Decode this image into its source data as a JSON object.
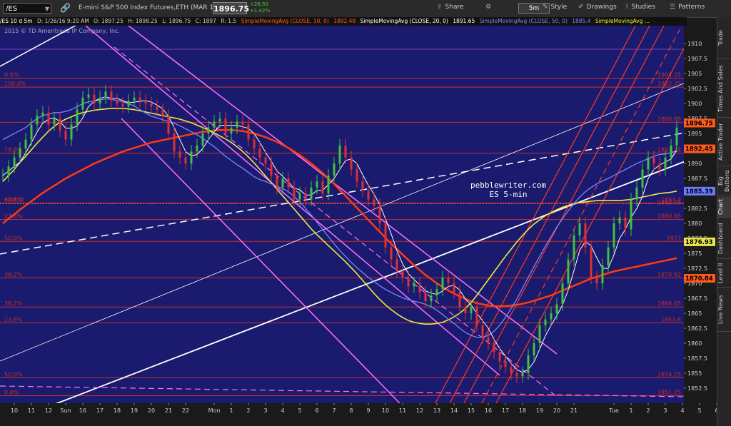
{
  "toolbar": {
    "symbol": "/ES",
    "description": "E-mini S&P 500 Index Futures,ETH (MAR 16)",
    "last": "1896.75",
    "change": "+26.50",
    "change_pct": "+1.42%",
    "share": "Share",
    "timeframe": "5m",
    "style": "Style",
    "drawings": "Drawings",
    "studies": "Studies",
    "patterns": "Patterns"
  },
  "infobar": {
    "label": "/ES 10 d 5m",
    "date": "D: 1/26/16 9:20 AM",
    "open": "O: 1897.25",
    "high": "H: 1898.25",
    "low": "L: 1896.75",
    "close": "C: 1897",
    "r": "R: 1.5",
    "sma10": "SimpleMovingAvg (CLOSE, 10, 0)",
    "sma10_val": "1892.48",
    "sma20": "SimpleMovingAvg (CLOSE, 20, 0)",
    "sma20_val": "1891.65",
    "sma50": "SimpleMovingAvg (CLOSE, 50, 0)",
    "sma50_val": "1885.4",
    "sma200": "SimpleMovingAvg ..."
  },
  "sidebar": [
    "Trade",
    "Times And Sales",
    "Active Trader",
    "Big Buttons",
    "Chart",
    "Dashboard",
    "Level II",
    "Live News"
  ],
  "chart_data": {
    "type": "line",
    "copyright": "2015 © TD Ameritrade IP Company, Inc.",
    "watermark_site": "pebblewriter.com",
    "watermark_sub": "ES 5-min",
    "ylim": [
      1850,
      1913
    ],
    "y_ticks": [
      1852.5,
      1855,
      1857.5,
      1860,
      1862.5,
      1865,
      1867.5,
      1870,
      1872.5,
      1875,
      1877.5,
      1880,
      1882.5,
      1885,
      1887.5,
      1890,
      1892.5,
      1895,
      1897.5,
      1900,
      1902.5,
      1905,
      1907.5,
      1910
    ],
    "x_ticks": [
      {
        "label": "10",
        "i": 2
      },
      {
        "label": "11",
        "i": 5
      },
      {
        "label": "12",
        "i": 8
      },
      {
        "label": "Sun",
        "i": 11
      },
      {
        "label": "16",
        "i": 14
      },
      {
        "label": "17",
        "i": 17
      },
      {
        "label": "18",
        "i": 20
      },
      {
        "label": "19",
        "i": 23
      },
      {
        "label": "20",
        "i": 26
      },
      {
        "label": "21",
        "i": 29
      },
      {
        "label": "22",
        "i": 32
      },
      {
        "label": "Mon",
        "i": 37
      },
      {
        "label": "1",
        "i": 40
      },
      {
        "label": "2",
        "i": 43
      },
      {
        "label": "3",
        "i": 46
      },
      {
        "label": "4",
        "i": 49
      },
      {
        "label": "5",
        "i": 52
      },
      {
        "label": "6",
        "i": 55
      },
      {
        "label": "7",
        "i": 58
      },
      {
        "label": "8",
        "i": 61
      },
      {
        "label": "9",
        "i": 64
      },
      {
        "label": "10",
        "i": 67
      },
      {
        "label": "11",
        "i": 70
      },
      {
        "label": "12",
        "i": 73
      },
      {
        "label": "13",
        "i": 76
      },
      {
        "label": "14",
        "i": 79
      },
      {
        "label": "15",
        "i": 82
      },
      {
        "label": "16",
        "i": 85
      },
      {
        "label": "17",
        "i": 88
      },
      {
        "label": "18",
        "i": 91
      },
      {
        "label": "19",
        "i": 94
      },
      {
        "label": "20",
        "i": 97
      },
      {
        "label": "21",
        "i": 100
      },
      {
        "label": "Tue",
        "i": 107
      },
      {
        "label": "1",
        "i": 110
      },
      {
        "label": "2",
        "i": 113
      },
      {
        "label": "3",
        "i": 116
      },
      {
        "label": "4",
        "i": 119
      },
      {
        "label": "5",
        "i": 122
      },
      {
        "label": "6",
        "i": 125
      },
      {
        "label": "7",
        "i": 128
      },
      {
        "label": "8",
        "i": 131
      },
      {
        "label": "9",
        "i": 134
      },
      {
        "label": "10",
        "i": 137
      },
      {
        "label": "11",
        "i": 140
      },
      {
        "label": "12",
        "i": 143
      },
      {
        "label": "13",
        "i": 146
      },
      {
        "label": "14",
        "i": 149
      },
      {
        "label": "15",
        "i": 152
      }
    ],
    "close": [
      1888,
      1889.5,
      1891,
      1892.5,
      1894,
      1896.5,
      1898,
      1898.5,
      1896.5,
      1897.5,
      1895.5,
      1894,
      1896.5,
      1899,
      1901,
      1901.5,
      1900,
      1901,
      1902,
      1900.5,
      1900,
      1899.5,
      1900.5,
      1901,
      1900.5,
      1900,
      1899.5,
      1899,
      1898,
      1895,
      1892,
      1891,
      1890,
      1892,
      1893,
      1895,
      1896,
      1897,
      1897.5,
      1895,
      1896,
      1897,
      1896.5,
      1894,
      1892.5,
      1891,
      1890,
      1888,
      1886,
      1887.5,
      1886,
      1884,
      1885,
      1884,
      1886,
      1887,
      1885,
      1888,
      1890,
      1893,
      1891,
      1889,
      1887,
      1885.5,
      1884,
      1883,
      1880,
      1876,
      1874,
      1872,
      1871,
      1869.5,
      1870,
      1868.5,
      1867,
      1868,
      1869,
      1871,
      1870,
      1868.5,
      1866,
      1865,
      1866,
      1863,
      1861,
      1860,
      1858.5,
      1857,
      1856,
      1855,
      1854.5,
      1855,
      1858,
      1860,
      1863,
      1864,
      1865,
      1866.5,
      1870,
      1874,
      1878,
      1880,
      1876,
      1871,
      1870,
      1873,
      1876,
      1880,
      1881,
      1879,
      1884,
      1886,
      1889,
      1891,
      1890,
      1889,
      1891,
      1893,
      1896
    ],
    "sma20": [
      1894,
      1894.5,
      1895,
      1895.5,
      1896,
      1896.8,
      1897.5,
      1898,
      1898.2,
      1898.5,
      1898.5,
      1898.7,
      1899,
      1899.5,
      1900,
      1900.3,
      1900.4,
      1900.6,
      1900.8,
      1900.7,
      1900.5,
      1900.3,
      1900,
      1899.6,
      1899,
      1898.4,
      1897.9,
      1897.6,
      1897.3,
      1897,
      1896.7,
      1896.3,
      1895.8,
      1895.3,
      1894.8,
      1894.2,
      1893.5,
      1892.8,
      1892,
      1891.2,
      1890.5,
      1889.8,
      1889.2,
      1888.5,
      1887.8,
      1887.3,
      1887,
      1886.6,
      1886.2,
      1885.8,
      1885.3,
      1884.5,
      1883.6,
      1882.5,
      1881.4,
      1880.2,
      1879,
      1877.8,
      1876.6,
      1875.5,
      1874.5,
      1873.5,
      1872.6,
      1871.8,
      1871,
      1870.3,
      1869.6,
      1869,
      1868.5,
      1868,
      1867.6,
      1867.3,
      1867,
      1866.8,
      1866.5,
      1866.1,
      1865.5,
      1864.8,
      1864,
      1863.3,
      1862.5,
      1861.8,
      1861.3,
      1861,
      1861,
      1861.3,
      1862,
      1863,
      1864.3,
      1865.8,
      1867.4,
      1869.2,
      1871,
      1872.8,
      1874.5,
      1876.2,
      1877.8,
      1879.4,
      1880.8,
      1882.1,
      1883.3,
      1884.4,
      1885.3,
      1886,
      1886.6,
      1887.1,
      1887.5,
      1888,
      1888.5,
      1889,
      1889.5,
      1890,
      1890.4,
      1890.8,
      1891.2,
      1891.5,
      1891.6,
      1891.8,
      1892.1
    ],
    "sma50": [
      1887,
      1888,
      1889,
      1890.2,
      1891.2,
      1892.3,
      1893.4,
      1894.4,
      1895.4,
      1896.2,
      1896.9,
      1897.4,
      1897.8,
      1898.2,
      1898.5,
      1898.7,
      1898.9,
      1899,
      1899.1,
      1899.2,
      1899.2,
      1899.2,
      1899.1,
      1899,
      1898.8,
      1898.6,
      1898.4,
      1898.2,
      1898,
      1897.8,
      1897.6,
      1897.4,
      1897.1,
      1896.8,
      1896.4,
      1896,
      1895.6,
      1895.1,
      1894.6,
      1894.1,
      1893.5,
      1892.8,
      1892,
      1891.1,
      1890.1,
      1889,
      1887.9,
      1886.8,
      1885.7,
      1884.6,
      1883.5,
      1882.4,
      1881.3,
      1880.2,
      1879.1,
      1878.1,
      1877.2,
      1876.3,
      1875.4,
      1874.5,
      1873.6,
      1872.6,
      1871.6,
      1870.5,
      1869.4,
      1868.3,
      1867.3,
      1866.4,
      1865.6,
      1864.9,
      1864.3,
      1863.8,
      1863.5,
      1863.3,
      1863.2,
      1863.2,
      1863.3,
      1863.5,
      1863.9,
      1864.4,
      1865,
      1865.8,
      1866.8,
      1868,
      1869.3,
      1870.6,
      1871.9,
      1873.2,
      1874.5,
      1875.7,
      1876.9,
      1878,
      1879,
      1879.9,
      1880.6,
      1881.3,
      1881.8,
      1882.3,
      1882.7,
      1883,
      1883.3,
      1883.5,
      1883.6,
      1883.7,
      1883.8,
      1883.8,
      1883.8,
      1883.8,
      1883.8,
      1883.9,
      1884,
      1884.2,
      1884.4,
      1884.6,
      1884.8,
      1885,
      1885.1,
      1885.2,
      1885.4
    ],
    "sma200": [
      1880,
      1880.8,
      1881.5,
      1882.3,
      1883,
      1883.7,
      1884.4,
      1885.1,
      1885.7,
      1886.3,
      1886.9,
      1887.5,
      1888,
      1888.5,
      1889,
      1889.5,
      1890,
      1890.4,
      1890.8,
      1891.2,
      1891.6,
      1892,
      1892.3,
      1892.6,
      1892.9,
      1893.2,
      1893.5,
      1893.7,
      1893.9,
      1894.1,
      1894.3,
      1894.5,
      1894.7,
      1894.9,
      1895.1,
      1895.3,
      1895.4,
      1895.5,
      1895.6,
      1895.6,
      1895.6,
      1895.5,
      1895.4,
      1895.2,
      1895,
      1894.7,
      1894.4,
      1894,
      1893.6,
      1893.1,
      1892.6,
      1892,
      1891.4,
      1890.7,
      1890,
      1889.2,
      1888.4,
      1887.5,
      1886.6,
      1885.6,
      1884.6,
      1883.6,
      1882.6,
      1881.6,
      1880.6,
      1879.6,
      1878.6,
      1877.6,
      1876.6,
      1875.7,
      1874.8,
      1873.9,
      1873,
      1872.2,
      1871.4,
      1870.7,
      1870,
      1869.4,
      1868.8,
      1868.3,
      1867.8,
      1867.4,
      1867,
      1866.7,
      1866.5,
      1866.3,
      1866.2,
      1866.2,
      1866.2,
      1866.3,
      1866.4,
      1866.6,
      1866.8,
      1867.1,
      1867.4,
      1867.7,
      1868,
      1868.4,
      1868.8,
      1869.2,
      1869.6,
      1870,
      1870.4,
      1870.8,
      1871.1,
      1871.4,
      1871.7,
      1872,
      1872.2,
      1872.4,
      1872.6,
      1872.8,
      1873,
      1873.2,
      1873.4,
      1873.6,
      1873.8,
      1874,
      1874.2
    ],
    "fib_levels": [
      {
        "price": 1904.25,
        "label": "0.0%",
        "right": "1904.25"
      },
      {
        "price": 1902.75,
        "label": "100.0%",
        "right": "1902.75"
      },
      {
        "price": 1896.88,
        "label": "",
        "right": "1896.88"
      },
      {
        "price": 1891.73,
        "label": "78.6%",
        "right": "1891.73"
      },
      {
        "price": 1883.4,
        "label": "61.8%",
        "right": "1883.4"
      },
      {
        "price": 1880.65,
        "label": "23.6%",
        "right": "1880.65"
      },
      {
        "price": 1877,
        "label": "50.0%",
        "right": "1877"
      },
      {
        "price": 1870.92,
        "label": "38.2%",
        "right": "1870.92"
      },
      {
        "price": 1866.05,
        "label": "38.2%",
        "right": "1866.05"
      },
      {
        "price": 1863.4,
        "label": "23.6%",
        "right": "1863.4"
      },
      {
        "price": 1854.25,
        "label": "50.0%",
        "right": "1854.25"
      },
      {
        "price": 1851.25,
        "label": "0.0%",
        "right": "1851.25"
      }
    ],
    "sma10_marker": {
      "price": 1883.3,
      "label": "SMA10",
      "value": "1883.08"
    },
    "price_tags": [
      {
        "price": 1896.75,
        "text": "1896.75",
        "color": "#ff5a1a"
      },
      {
        "price": 1892.45,
        "text": "1892.45",
        "color": "#ff5a1a"
      },
      {
        "price": 1885.39,
        "text": "1885.39",
        "color": "#6b7bff"
      },
      {
        "price": 1876.93,
        "text": "1876.93",
        "color": "#e8e64a"
      },
      {
        "price": 1870.84,
        "text": "1870.84",
        "color": "#ff5a1a"
      }
    ],
    "colors": {
      "background": "#1a1a6e",
      "price": "#3cc43c",
      "price_down": "#e03030",
      "sma10": "#ffffff",
      "sma20": "#7a86ff",
      "sma50": "#ecec40",
      "sma200": "#ff3a12",
      "fib": "#c8302a",
      "channel_magenta": "#ff70ff",
      "channel_red": "#ff3a20",
      "trend_white": "#ffffff"
    }
  }
}
